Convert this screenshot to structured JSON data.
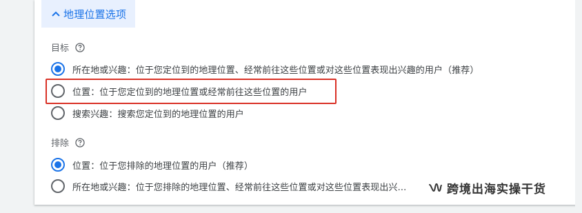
{
  "section": {
    "title": "地理位置选项",
    "accent_color": "#1a73e8",
    "expanded_icon": "chevron-up-icon"
  },
  "target": {
    "label": "目标",
    "help_icon": "help-circle-icon",
    "options": [
      {
        "label": "所在地或兴趣：位于您定位到的地理位置、经常前往这些位置或对这些位置表现出兴趣的用户（推荐）",
        "selected": true
      },
      {
        "label": "位置：位于您定位到的地理位置或经常前往这些位置的用户",
        "selected": false
      },
      {
        "label": "搜索兴趣：搜索您定位到的地理位置的用户",
        "selected": false
      }
    ]
  },
  "exclude": {
    "label": "排除",
    "help_icon": "help-circle-icon",
    "options": [
      {
        "label": "位置：位于您排除的地理位置的用户（推荐）",
        "selected": true
      },
      {
        "label": "所在地或兴趣：位于您排除的地理位置、经常前往这些位置或对这些位置表现出兴...",
        "selected": false
      }
    ]
  },
  "annotation": {
    "highlight_color": "#d93025"
  },
  "watermark": {
    "text": "跨境出海实操干货",
    "icon": "wechat-channel-icon"
  }
}
